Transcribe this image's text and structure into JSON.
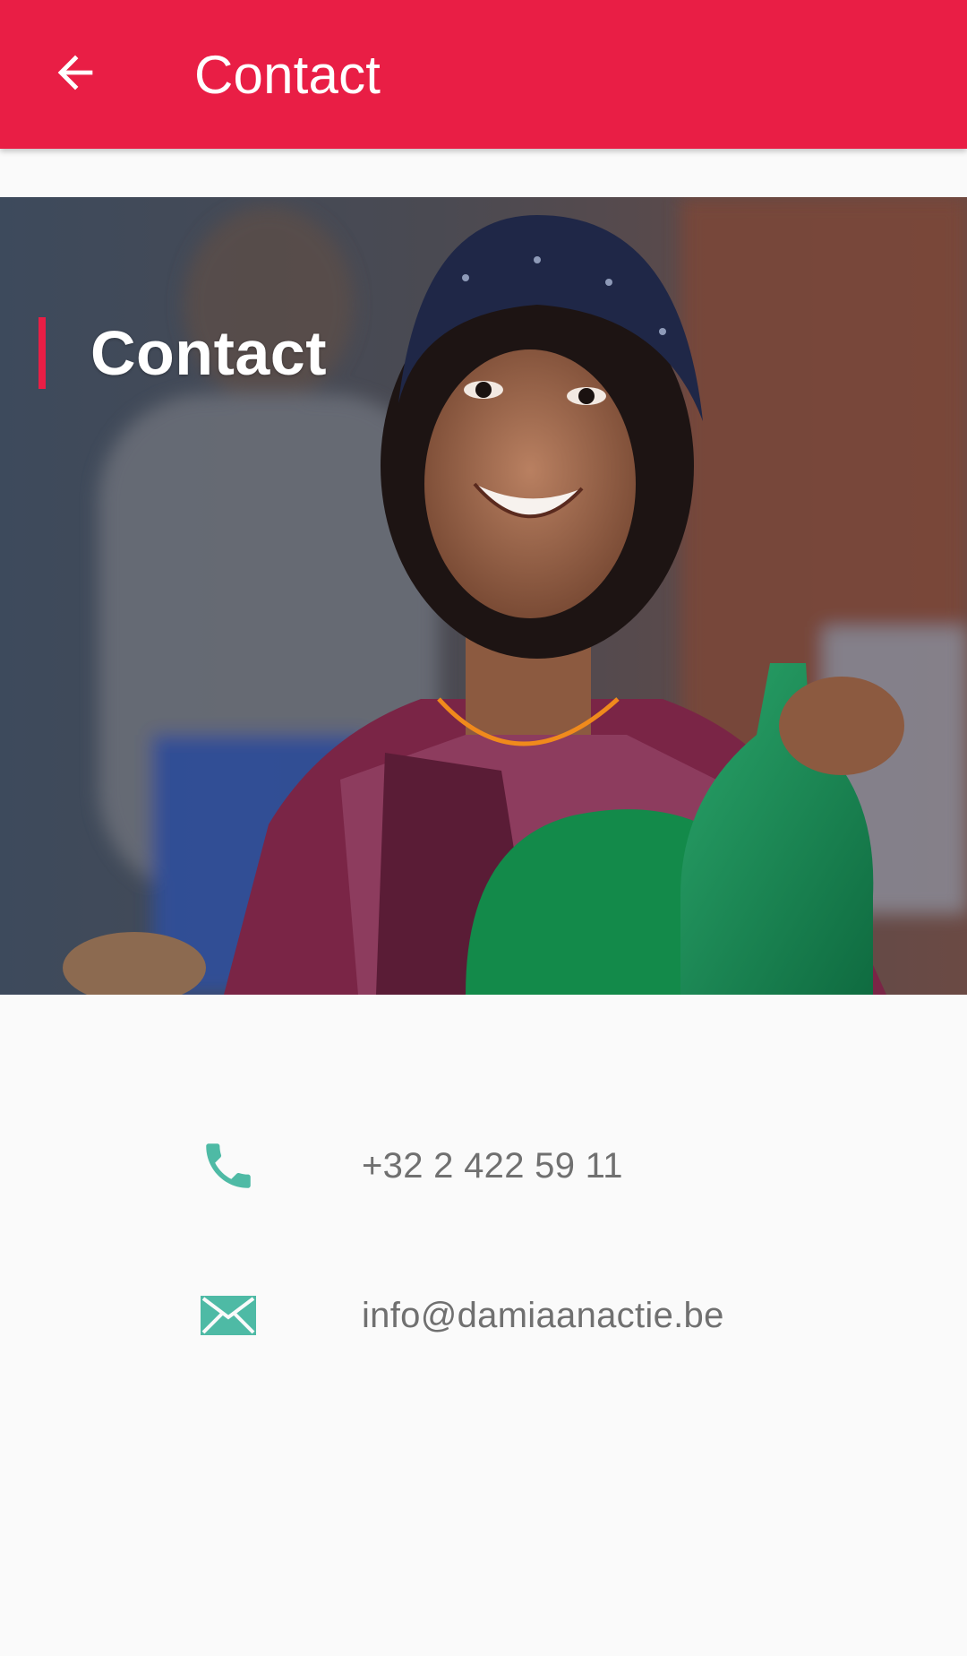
{
  "app_bar": {
    "title": "Contact",
    "back_icon": "arrow-back-icon",
    "background_color": "#e91e45"
  },
  "hero": {
    "label": "Contact",
    "accent_color": "#e91e45",
    "image_description_icon": "photo-child-smiling"
  },
  "contacts": {
    "phone": {
      "icon": "phone-icon",
      "value": "+32 2 422 59 11"
    },
    "email": {
      "icon": "mail-icon",
      "value": "info@damiaanactie.be"
    },
    "icon_color": "#4ebaa5"
  }
}
